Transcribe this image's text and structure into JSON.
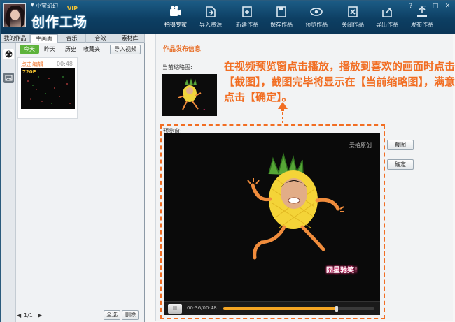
{
  "header": {
    "username": "小宝幻幻",
    "vip": "VIP",
    "brand": "创作工场",
    "tools": [
      {
        "label": "拍摄专家",
        "icon": "camera-icon"
      },
      {
        "label": "导入资源",
        "icon": "import-icon"
      },
      {
        "label": "新建作品",
        "icon": "new-icon"
      },
      {
        "label": "保存作品",
        "icon": "save-icon"
      },
      {
        "label": "预览作品",
        "icon": "eye-icon"
      },
      {
        "label": "关闭作品",
        "icon": "close-doc-icon"
      },
      {
        "label": "导出作品",
        "icon": "export-icon"
      },
      {
        "label": "发布作品",
        "icon": "publish-icon"
      }
    ],
    "window_buttons": [
      "?",
      "—",
      "□",
      "✕"
    ]
  },
  "left": {
    "tabs": [
      "我的作品",
      "主画面",
      "音乐",
      "音效",
      "素材库"
    ],
    "active_tab": 1,
    "filters": [
      "今天",
      "昨天",
      "历史",
      "收藏夹"
    ],
    "import_label": "导入视频",
    "card": {
      "title": "点击编辑",
      "duration": "00:48",
      "badge": "720P"
    },
    "pager": "1/1",
    "select_all": "全选",
    "delete": "删除"
  },
  "right": {
    "section_title": "作品发布信息",
    "current_thumb_label": "当前缩略图:",
    "preview_label": "预览窗:",
    "annotation": "在视频预览窗点击播放，播放到喜欢的画面时点击【截图】，截图完毕将显示在【当前缩略图】，满意点击【确定】。",
    "watermark": "爱拍原创",
    "caption": "囧星驰笑！",
    "play_button": "II",
    "time": "00:36/00:48",
    "progress": 0.75,
    "screenshot_button": "截图",
    "confirm_button": "确定"
  },
  "colors": {
    "accent": "#f26e23",
    "toolbar": "#0d3f63",
    "progress": "#f5a623"
  }
}
